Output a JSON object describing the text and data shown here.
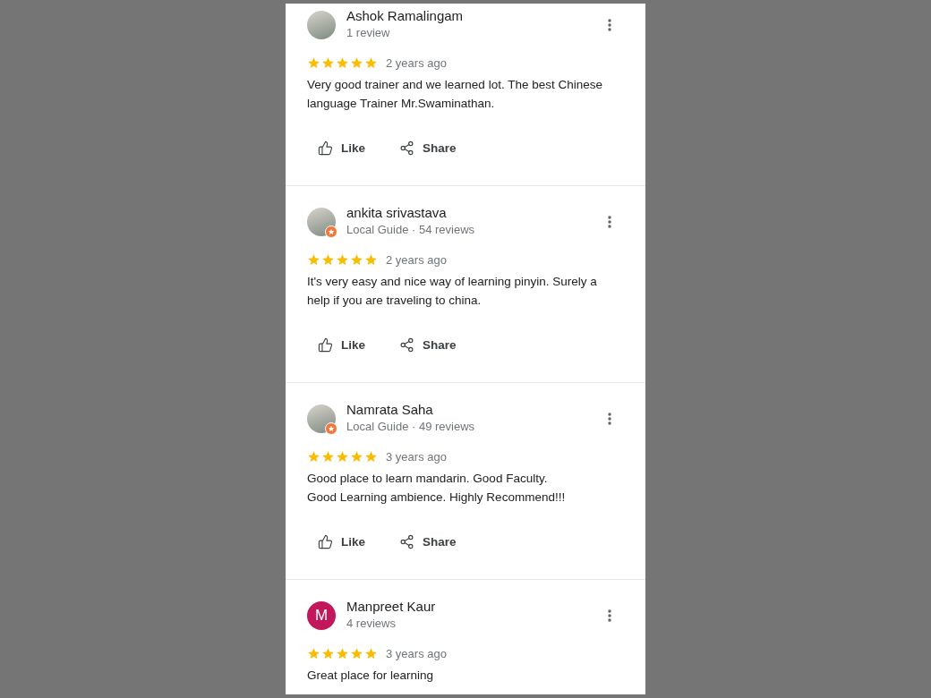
{
  "reviews": [
    {
      "name": "Ashok Ramalingam",
      "subtitle": "1 review",
      "avatar": {
        "kind": "photo"
      },
      "local_guide": false,
      "stars": 5,
      "time": "2 years ago",
      "text": "Very good trainer and we learned lot. The best Chinese language Trainer Mr.Swaminathan.",
      "actions": [
        "Like",
        "Share"
      ]
    },
    {
      "name": "ankita srivastava",
      "subtitle": "Local Guide · 54 reviews",
      "avatar": {
        "kind": "photo"
      },
      "local_guide": true,
      "stars": 5,
      "time": "2 years ago",
      "text": "It's very easy and nice way of learning pinyin. Surely a help if you are traveling to china.",
      "actions": [
        "Like",
        "Share"
      ]
    },
    {
      "name": "Namrata Saha",
      "subtitle": "Local Guide · 49 reviews",
      "avatar": {
        "kind": "photo"
      },
      "local_guide": true,
      "stars": 5,
      "time": "3 years ago",
      "text": "Good place to learn mandarin. Good Faculty.\nGood Learning ambience. Highly Recommend!!!",
      "actions": [
        "Like",
        "Share"
      ]
    },
    {
      "name": "Manpreet Kaur",
      "subtitle": "4 reviews",
      "avatar": {
        "kind": "letter",
        "letter": "M",
        "color": "#c2185b"
      },
      "local_guide": false,
      "stars": 5,
      "time": "3 years ago",
      "text": "Great place for learning"
    }
  ]
}
